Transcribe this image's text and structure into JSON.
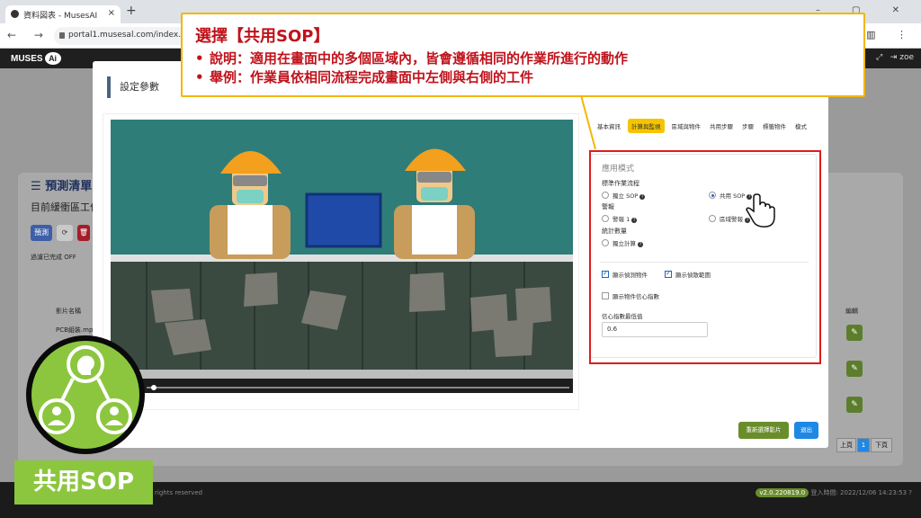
{
  "browser": {
    "tab_title": "資料図表 - MusesAI",
    "url": "portal1.musesal.com/index.html#ap",
    "profile": "zoe"
  },
  "app": {
    "logo_text": "MUSES",
    "logo_ai": "Ai"
  },
  "background_page": {
    "title": "預測清單",
    "subtitle": "目前緩衝區工作",
    "buttons": [
      "預測"
    ],
    "filter_label": "過濾已完成",
    "filter_toggle": "OFF",
    "table_header": "影片名稱",
    "table_header_right": "編輯",
    "row_name": "PCB組裝.mp",
    "pager": {
      "prev": "上頁",
      "page": "1",
      "next": "下頁"
    },
    "footer_left": "rights reserved",
    "version": "v2.0.220819.0",
    "last_login": "登入時間: 2022/12/06 14:23:53"
  },
  "modal": {
    "title": "設定參數",
    "tabs": [
      "基本資訊",
      "計算與監視",
      "區域與物件",
      "共用步驟",
      "步驟",
      "標籤物件",
      "模式"
    ],
    "active_tab_index": 1,
    "config": {
      "heading": "應用模式",
      "sections": [
        {
          "label": "標準作業流程",
          "options": [
            "獨立 SOP",
            "共用 SOP"
          ],
          "selected": 1
        },
        {
          "label": "警報",
          "options": [
            "警報 1",
            "區域警報"
          ],
          "selected": -1
        },
        {
          "label": "統計數量",
          "options": [
            "獨立計算"
          ],
          "selected": -1
        }
      ],
      "checkboxes": [
        {
          "label": "顯示偵測物件",
          "checked": true
        },
        {
          "label": "顯示偵散範圍",
          "checked": true
        },
        {
          "label": "顯示物件信心指數",
          "checked": false
        }
      ],
      "threshold_label": "信心指數最低值",
      "threshold_value": "0.6"
    },
    "btn_reselect": "重新選擇影片",
    "btn_exit": "退出"
  },
  "callout": {
    "heading": "選擇【共用SOP】",
    "bullets": [
      "說明：適用在畫面中的多個區域內，皆會遵循相同的作業所進行的動作",
      "舉例：作業員依相同流程完成畫面中左側與右側的工件"
    ]
  },
  "badge": {
    "label": "共用SOP"
  },
  "colors": {
    "accent_yellow": "#f5c400",
    "highlight_red": "#e01b1b",
    "brand_green": "#8cc63f",
    "primary_blue": "#1e88e5"
  }
}
